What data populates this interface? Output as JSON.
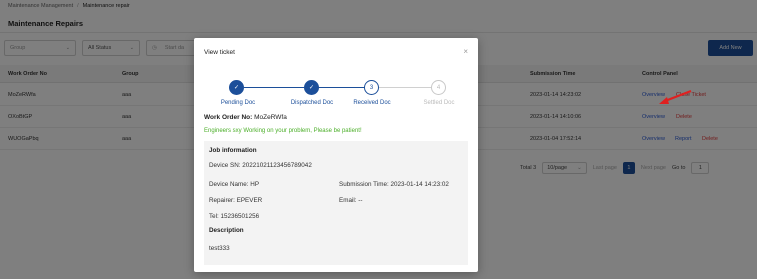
{
  "breadcrumb": {
    "parent": "Maintenance Management",
    "separator": "/",
    "current": "Maintenance repair"
  },
  "page_title": "Maintenance Repairs",
  "filters": {
    "group_placeholder": "Group",
    "status_value": "All Status",
    "date_placeholder": "Start da"
  },
  "add_button": "Add New",
  "table": {
    "headers": [
      "Work Order No",
      "Group",
      "Submission Time",
      "Control Panel"
    ],
    "rows": [
      {
        "order": "MoZeRWfa",
        "group": "aaa",
        "time": "2023-01-14 14:23:02",
        "actions": [
          "Overview",
          "Close Ticket"
        ]
      },
      {
        "order": "OXoBtGP",
        "group": "aaa",
        "time": "2023-01-14 14:10:06",
        "actions": [
          "Overview",
          "Delete"
        ]
      },
      {
        "order": "WUOGaPbq",
        "group": "aaa",
        "time": "2023-01-04 17:52:14",
        "actions": [
          "Overview",
          "Report",
          "Delete"
        ]
      }
    ]
  },
  "pager": {
    "total": "Total 3",
    "per_page": "10/page",
    "last": "Last page",
    "current": "1",
    "next": "Next page",
    "goto": "Go to",
    "goto_value": "1"
  },
  "modal": {
    "title": "View ticket",
    "close": "×",
    "steps": [
      {
        "label": "Pending Doc",
        "mark": "✓",
        "state": "done"
      },
      {
        "label": "Dispatched Doc",
        "mark": "✓",
        "state": "done"
      },
      {
        "label": "Received Doc",
        "mark": "3",
        "state": "current"
      },
      {
        "label": "Settled Doc",
        "mark": "4",
        "state": "todo"
      }
    ],
    "work_order_label": "Work Order No:",
    "work_order_value": "MoZeRWfa",
    "note": "Engineers sxy Working on your problem, Please be patient!",
    "job_info_title": "Job information",
    "device_sn": "Device SN: 20221021123456789042",
    "device_name": "Device Name: HP",
    "submission_time": "Submission Time: 2023-01-14 14:23:02",
    "repairer": "Repairer: EPEVER",
    "email": "Email: --",
    "tel": "Tel: 15236501256",
    "description_title": "Description",
    "description_text": "test333"
  },
  "colors": {
    "primary": "#1c4f9a",
    "success": "#4caf2a",
    "danger": "#e23b3b",
    "link": "#2a5bd7"
  }
}
